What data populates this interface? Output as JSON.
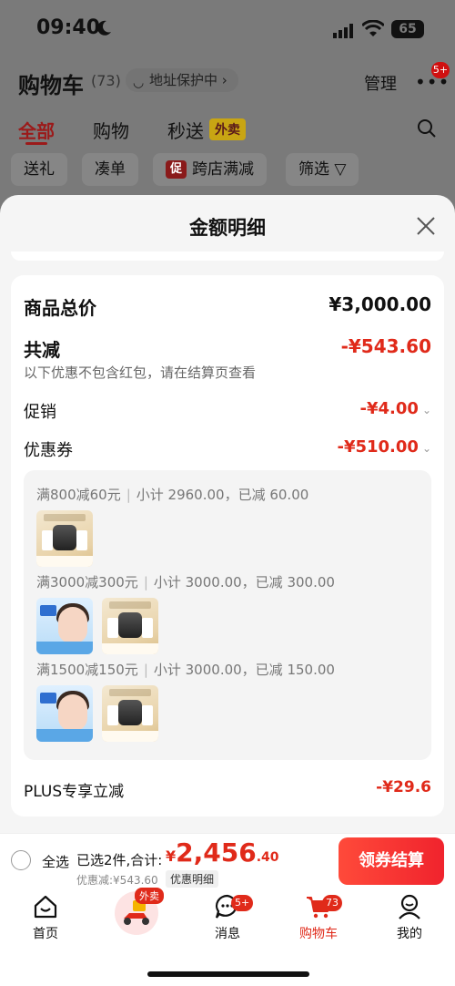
{
  "status_bar": {
    "time": "09:40",
    "battery": "65"
  },
  "header": {
    "title": "购物车",
    "count": "(73)",
    "address_protect": "地址保护中",
    "manage": "管理",
    "more_badge": "5+"
  },
  "tabs": [
    {
      "label": "全部",
      "active": true
    },
    {
      "label": "购物"
    },
    {
      "label": "秒送",
      "tag": "外卖"
    }
  ],
  "chips": [
    "送礼",
    "凑单",
    "跨店满减",
    "筛选"
  ],
  "chip_tag": "促",
  "sheet": {
    "title": "金额明细",
    "total_label": "商品总价",
    "total_value": "¥3,000.00",
    "reduction_label": "共减",
    "reduction_value": "-¥543.60",
    "reduction_note": "以下优惠不包含红包，请在结算页查看",
    "promo_label": "促销",
    "promo_value": "-¥4.00",
    "coupon_label": "优惠券",
    "coupon_value": "-¥510.00",
    "coupon_groups": [
      {
        "rule": "满800减60元",
        "detail": "小计 2960.00，已减 60.00",
        "thumbs": [
          "cream"
        ]
      },
      {
        "rule": "满3000减300元",
        "detail": "小计 3000.00，已减 300.00",
        "thumbs": [
          "blue",
          "cream"
        ]
      },
      {
        "rule": "满1500减150元",
        "detail": "小计 3000.00，已减 150.00",
        "thumbs": [
          "blue",
          "cream"
        ]
      }
    ],
    "plus_label": "PLUS专享立减",
    "plus_value": "-¥29.6"
  },
  "checkout": {
    "select_all": "全选",
    "selected": "已选2件,合计:",
    "currency": "¥",
    "amount_int": "2,456",
    "amount_dec": ".40",
    "discount": "优惠减:¥543.60",
    "discount_detail": "优惠明细",
    "button": "领券结算"
  },
  "nav": {
    "home": "首页",
    "delivery_tag": "外卖",
    "messages": "消息",
    "messages_badge": "5+",
    "cart": "购物车",
    "cart_badge": "73",
    "me": "我的"
  },
  "colors": {
    "accent_red": "#e02a1a",
    "dim_background": "#7a7a7a"
  }
}
